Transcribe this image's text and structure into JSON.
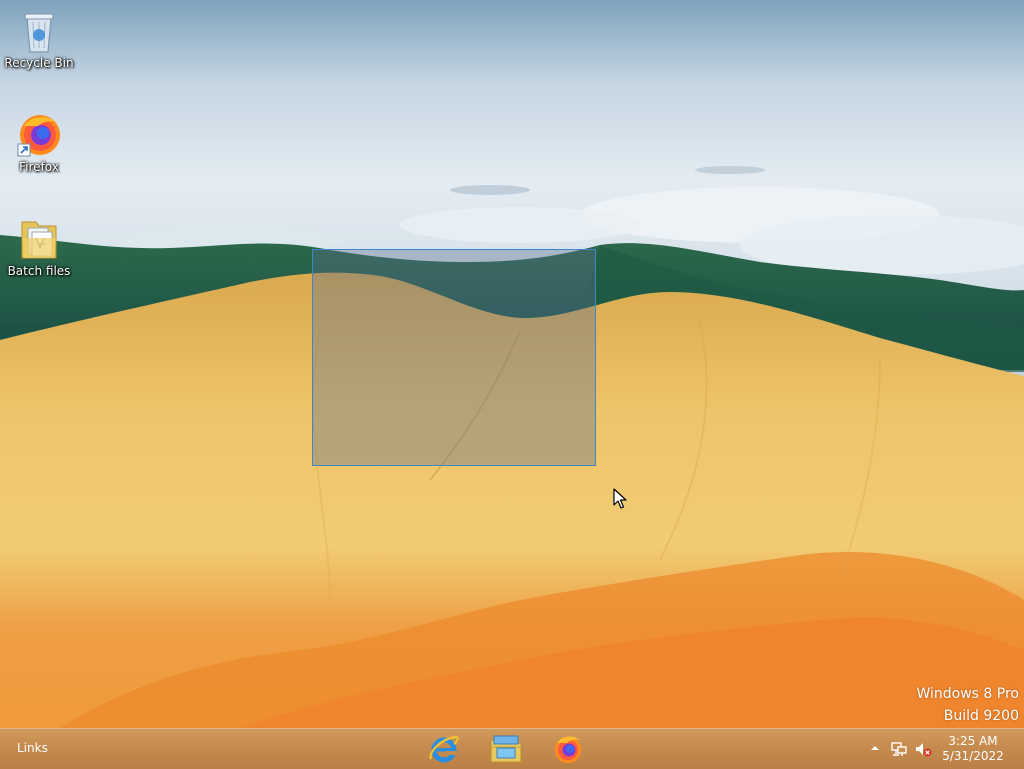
{
  "desktop": {
    "icons": [
      {
        "label": "Recycle Bin",
        "icon": "recycle-bin-icon"
      },
      {
        "label": "Firefox",
        "icon": "firefox-icon"
      },
      {
        "label": "Batch files",
        "icon": "folder-icon"
      }
    ],
    "watermark": {
      "line1": "Windows 8 Pro",
      "line2": "Build 9200"
    }
  },
  "taskbar": {
    "links_label": "Links",
    "pinned": [
      {
        "icon": "internet-explorer-icon"
      },
      {
        "icon": "file-explorer-icon"
      },
      {
        "icon": "firefox-icon"
      }
    ],
    "tray": {
      "icons": [
        "show-hidden-icons-chevron",
        "network-icon",
        "volume-muted-icon"
      ],
      "time": "3:25 AM",
      "date": "5/31/2022"
    }
  },
  "colors": {
    "taskbar": "#c68b4e",
    "selection_border": "#3d86c8",
    "sky": "#d4dfe8",
    "hill_yellow": "#e8b957",
    "hill_orange": "#e8832e",
    "forest": "#1f5a3c"
  }
}
